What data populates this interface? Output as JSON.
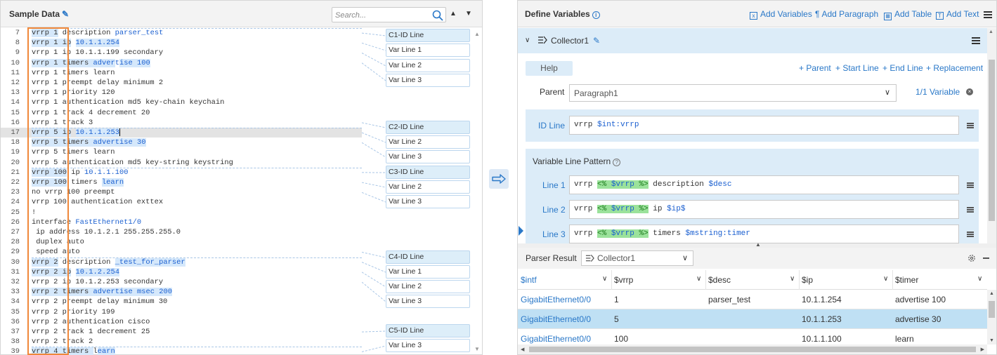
{
  "left": {
    "title": "Sample Data",
    "search_placeholder": "Search...",
    "lines": [
      {
        "n": "7",
        "t": "vrrp 1 description parser_test"
      },
      {
        "n": "8",
        "t": "vrrp 1 ip 10.1.1.254"
      },
      {
        "n": "9",
        "t": "vrrp 1 ip 10.1.1.199 secondary"
      },
      {
        "n": "10",
        "t": "vrrp 1 timers advertise 100"
      },
      {
        "n": "11",
        "t": "vrrp 1 timers learn"
      },
      {
        "n": "12",
        "t": "vrrp 1 preempt delay minimum 2"
      },
      {
        "n": "13",
        "t": "vrrp 1 priority 120"
      },
      {
        "n": "14",
        "t": "vrrp 1 authentication md5 key-chain keychain"
      },
      {
        "n": "15",
        "t": "vrrp 1 track 4 decrement 20"
      },
      {
        "n": "16",
        "t": "vrrp 1 track 3"
      },
      {
        "n": "17",
        "t": "vrrp 5 ip 10.1.1.253"
      },
      {
        "n": "18",
        "t": "vrrp 5 timers advertise 30"
      },
      {
        "n": "19",
        "t": "vrrp 5 timers learn"
      },
      {
        "n": "20",
        "t": "vrrp 5 authentication md5 key-string keystring"
      },
      {
        "n": "21",
        "t": "vrrp 100 ip 10.1.1.100"
      },
      {
        "n": "22",
        "t": "vrrp 100 timers learn"
      },
      {
        "n": "23",
        "t": "no vrrp 100 preempt"
      },
      {
        "n": "24",
        "t": "vrrp 100 authentication exttex"
      },
      {
        "n": "25",
        "t": "!"
      },
      {
        "n": "26",
        "t": "interface FastEthernet1/0"
      },
      {
        "n": "27",
        "t": " ip address 10.1.2.1 255.255.255.0"
      },
      {
        "n": "28",
        "t": " duplex auto"
      },
      {
        "n": "29",
        "t": " speed auto"
      },
      {
        "n": "30",
        "t": "vrrp 2 description _test_for_parser"
      },
      {
        "n": "31",
        "t": "vrrp 2 ip 10.1.2.254"
      },
      {
        "n": "32",
        "t": "vrrp 2 ip 10.1.2.253 secondary"
      },
      {
        "n": "33",
        "t": "vrrp 2 timers advertise msec 200"
      },
      {
        "n": "34",
        "t": "vrrp 2 preempt delay minimum 30"
      },
      {
        "n": "35",
        "t": "vrrp 2 priority 199"
      },
      {
        "n": "36",
        "t": "vrrp 2 authentication cisco"
      },
      {
        "n": "37",
        "t": "vrrp 2 track 1 decrement 25"
      },
      {
        "n": "38",
        "t": "vrrp 2 track 2"
      },
      {
        "n": "39",
        "t": "vrrp 4 timers learn"
      }
    ],
    "tags": [
      {
        "label": "C1-ID Line",
        "kind": "id"
      },
      {
        "label": "Var Line 1",
        "kind": "var"
      },
      {
        "label": "Var Line 2",
        "kind": "var"
      },
      {
        "label": "Var Line 3",
        "kind": "var"
      },
      {
        "label": "C2-ID Line",
        "kind": "id"
      },
      {
        "label": "Var Line 2",
        "kind": "var"
      },
      {
        "label": "Var Line 3",
        "kind": "var"
      },
      {
        "label": "C3-ID Line",
        "kind": "id"
      },
      {
        "label": "Var Line 2",
        "kind": "var"
      },
      {
        "label": "Var Line 3",
        "kind": "var"
      },
      {
        "label": "C4-ID Line",
        "kind": "id"
      },
      {
        "label": "Var Line 1",
        "kind": "var"
      },
      {
        "label": "Var Line 2",
        "kind": "var"
      },
      {
        "label": "Var Line 3",
        "kind": "var"
      },
      {
        "label": "C5-ID Line",
        "kind": "id"
      },
      {
        "label": "Var Line 3",
        "kind": "var"
      }
    ]
  },
  "right": {
    "title": "Define Variables",
    "header_actions": {
      "add_variables": "Add Variables",
      "add_paragraph": "Add Paragraph",
      "add_table": "Add Table",
      "add_text": "Add Text"
    },
    "collector": {
      "name": "Collector1",
      "help": "Help",
      "links": {
        "parent": "+ Parent",
        "start_line": "+ Start Line",
        "end_line": "+ End Line",
        "replacement": "+ Replacement"
      },
      "parent_label": "Parent",
      "parent_value": "Paragraph1",
      "variable_count": "1/1 Variable",
      "id_line_label": "ID Line",
      "id_line": {
        "pre": "vrrp ",
        "var": "$int:vrrp"
      },
      "vlp_title": "Variable Line Pattern",
      "lines": [
        {
          "label": "Line 1",
          "pre": "vrrp ",
          "g_open": "<% ",
          "g_var": "$vrrp",
          "g_close": " %>",
          "mid": " description ",
          "var": "$desc"
        },
        {
          "label": "Line 2",
          "pre": "vrrp ",
          "g_open": "<% ",
          "g_var": "$vrrp",
          "g_close": " %>",
          "mid": " ip ",
          "var": "$ip$"
        },
        {
          "label": "Line 3",
          "pre": "vrrp ",
          "g_open": "<% ",
          "g_var": "$vrrp",
          "g_close": " %>",
          "mid": " timers ",
          "var": "$mstring:timer"
        }
      ]
    },
    "parser": {
      "title": "Parser Result",
      "selected": "Collector1",
      "columns": [
        "$intf",
        "$vrrp",
        "$desc",
        "$ip",
        "$timer"
      ],
      "rows": [
        [
          "GigabitEthernet0/0",
          "1",
          "parser_test",
          "10.1.1.254",
          "advertise 100"
        ],
        [
          "GigabitEthernet0/0",
          "5",
          "",
          "10.1.1.253",
          "advertise 30"
        ],
        [
          "GigabitEthernet0/0",
          "100",
          "",
          "10.1.1.100",
          "learn"
        ]
      ]
    }
  }
}
